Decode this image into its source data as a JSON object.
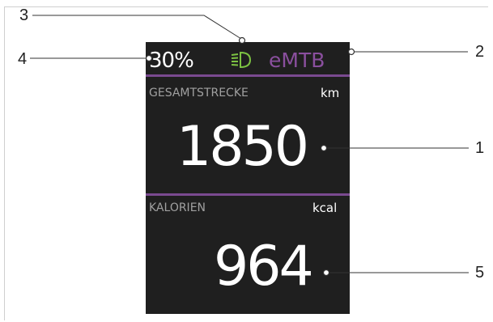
{
  "display": {
    "battery": "30%",
    "mode": "eMTB",
    "total_distance": {
      "label": "GESAMTSTRECKE",
      "unit": "km",
      "value": "1850"
    },
    "calories": {
      "label": "KALORIEN",
      "unit": "kcal",
      "value": "964"
    }
  },
  "callouts": [
    "1",
    "2",
    "3",
    "4",
    "5"
  ],
  "colors": {
    "display_bg": "#1f1f1f",
    "mode_purple": "#8a4f9e",
    "divider_purple": "#7a4a90",
    "light_green": "#7cc242",
    "label_gray": "#a0a0a0"
  },
  "icons": {
    "light": "headlight-icon"
  }
}
